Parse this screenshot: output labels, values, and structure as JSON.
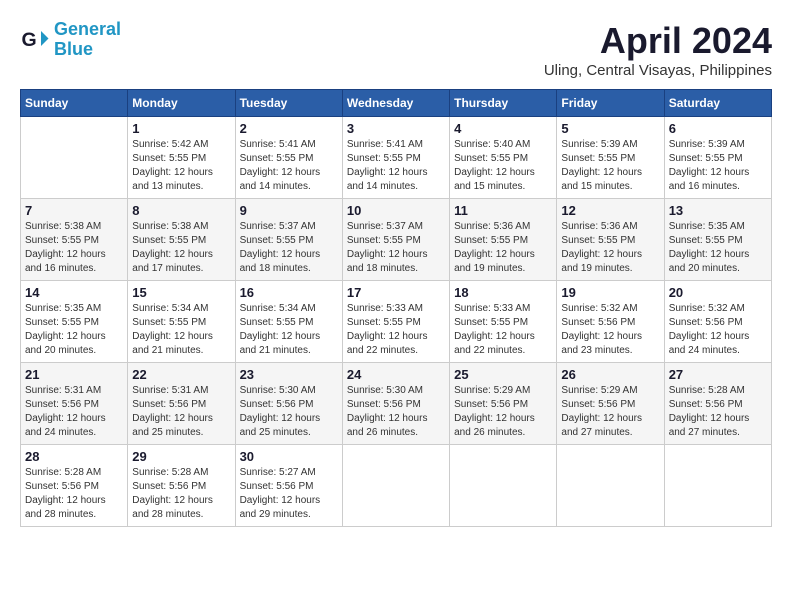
{
  "logo": {
    "line1": "General",
    "line2": "Blue"
  },
  "title": "April 2024",
  "location": "Uling, Central Visayas, Philippines",
  "days_header": [
    "Sunday",
    "Monday",
    "Tuesday",
    "Wednesday",
    "Thursday",
    "Friday",
    "Saturday"
  ],
  "weeks": [
    [
      {
        "day": "",
        "info": ""
      },
      {
        "day": "1",
        "info": "Sunrise: 5:42 AM\nSunset: 5:55 PM\nDaylight: 12 hours\nand 13 minutes."
      },
      {
        "day": "2",
        "info": "Sunrise: 5:41 AM\nSunset: 5:55 PM\nDaylight: 12 hours\nand 14 minutes."
      },
      {
        "day": "3",
        "info": "Sunrise: 5:41 AM\nSunset: 5:55 PM\nDaylight: 12 hours\nand 14 minutes."
      },
      {
        "day": "4",
        "info": "Sunrise: 5:40 AM\nSunset: 5:55 PM\nDaylight: 12 hours\nand 15 minutes."
      },
      {
        "day": "5",
        "info": "Sunrise: 5:39 AM\nSunset: 5:55 PM\nDaylight: 12 hours\nand 15 minutes."
      },
      {
        "day": "6",
        "info": "Sunrise: 5:39 AM\nSunset: 5:55 PM\nDaylight: 12 hours\nand 16 minutes."
      }
    ],
    [
      {
        "day": "7",
        "info": "Sunrise: 5:38 AM\nSunset: 5:55 PM\nDaylight: 12 hours\nand 16 minutes."
      },
      {
        "day": "8",
        "info": "Sunrise: 5:38 AM\nSunset: 5:55 PM\nDaylight: 12 hours\nand 17 minutes."
      },
      {
        "day": "9",
        "info": "Sunrise: 5:37 AM\nSunset: 5:55 PM\nDaylight: 12 hours\nand 18 minutes."
      },
      {
        "day": "10",
        "info": "Sunrise: 5:37 AM\nSunset: 5:55 PM\nDaylight: 12 hours\nand 18 minutes."
      },
      {
        "day": "11",
        "info": "Sunrise: 5:36 AM\nSunset: 5:55 PM\nDaylight: 12 hours\nand 19 minutes."
      },
      {
        "day": "12",
        "info": "Sunrise: 5:36 AM\nSunset: 5:55 PM\nDaylight: 12 hours\nand 19 minutes."
      },
      {
        "day": "13",
        "info": "Sunrise: 5:35 AM\nSunset: 5:55 PM\nDaylight: 12 hours\nand 20 minutes."
      }
    ],
    [
      {
        "day": "14",
        "info": "Sunrise: 5:35 AM\nSunset: 5:55 PM\nDaylight: 12 hours\nand 20 minutes."
      },
      {
        "day": "15",
        "info": "Sunrise: 5:34 AM\nSunset: 5:55 PM\nDaylight: 12 hours\nand 21 minutes."
      },
      {
        "day": "16",
        "info": "Sunrise: 5:34 AM\nSunset: 5:55 PM\nDaylight: 12 hours\nand 21 minutes."
      },
      {
        "day": "17",
        "info": "Sunrise: 5:33 AM\nSunset: 5:55 PM\nDaylight: 12 hours\nand 22 minutes."
      },
      {
        "day": "18",
        "info": "Sunrise: 5:33 AM\nSunset: 5:55 PM\nDaylight: 12 hours\nand 22 minutes."
      },
      {
        "day": "19",
        "info": "Sunrise: 5:32 AM\nSunset: 5:56 PM\nDaylight: 12 hours\nand 23 minutes."
      },
      {
        "day": "20",
        "info": "Sunrise: 5:32 AM\nSunset: 5:56 PM\nDaylight: 12 hours\nand 24 minutes."
      }
    ],
    [
      {
        "day": "21",
        "info": "Sunrise: 5:31 AM\nSunset: 5:56 PM\nDaylight: 12 hours\nand 24 minutes."
      },
      {
        "day": "22",
        "info": "Sunrise: 5:31 AM\nSunset: 5:56 PM\nDaylight: 12 hours\nand 25 minutes."
      },
      {
        "day": "23",
        "info": "Sunrise: 5:30 AM\nSunset: 5:56 PM\nDaylight: 12 hours\nand 25 minutes."
      },
      {
        "day": "24",
        "info": "Sunrise: 5:30 AM\nSunset: 5:56 PM\nDaylight: 12 hours\nand 26 minutes."
      },
      {
        "day": "25",
        "info": "Sunrise: 5:29 AM\nSunset: 5:56 PM\nDaylight: 12 hours\nand 26 minutes."
      },
      {
        "day": "26",
        "info": "Sunrise: 5:29 AM\nSunset: 5:56 PM\nDaylight: 12 hours\nand 27 minutes."
      },
      {
        "day": "27",
        "info": "Sunrise: 5:28 AM\nSunset: 5:56 PM\nDaylight: 12 hours\nand 27 minutes."
      }
    ],
    [
      {
        "day": "28",
        "info": "Sunrise: 5:28 AM\nSunset: 5:56 PM\nDaylight: 12 hours\nand 28 minutes."
      },
      {
        "day": "29",
        "info": "Sunrise: 5:28 AM\nSunset: 5:56 PM\nDaylight: 12 hours\nand 28 minutes."
      },
      {
        "day": "30",
        "info": "Sunrise: 5:27 AM\nSunset: 5:56 PM\nDaylight: 12 hours\nand 29 minutes."
      },
      {
        "day": "",
        "info": ""
      },
      {
        "day": "",
        "info": ""
      },
      {
        "day": "",
        "info": ""
      },
      {
        "day": "",
        "info": ""
      }
    ]
  ]
}
